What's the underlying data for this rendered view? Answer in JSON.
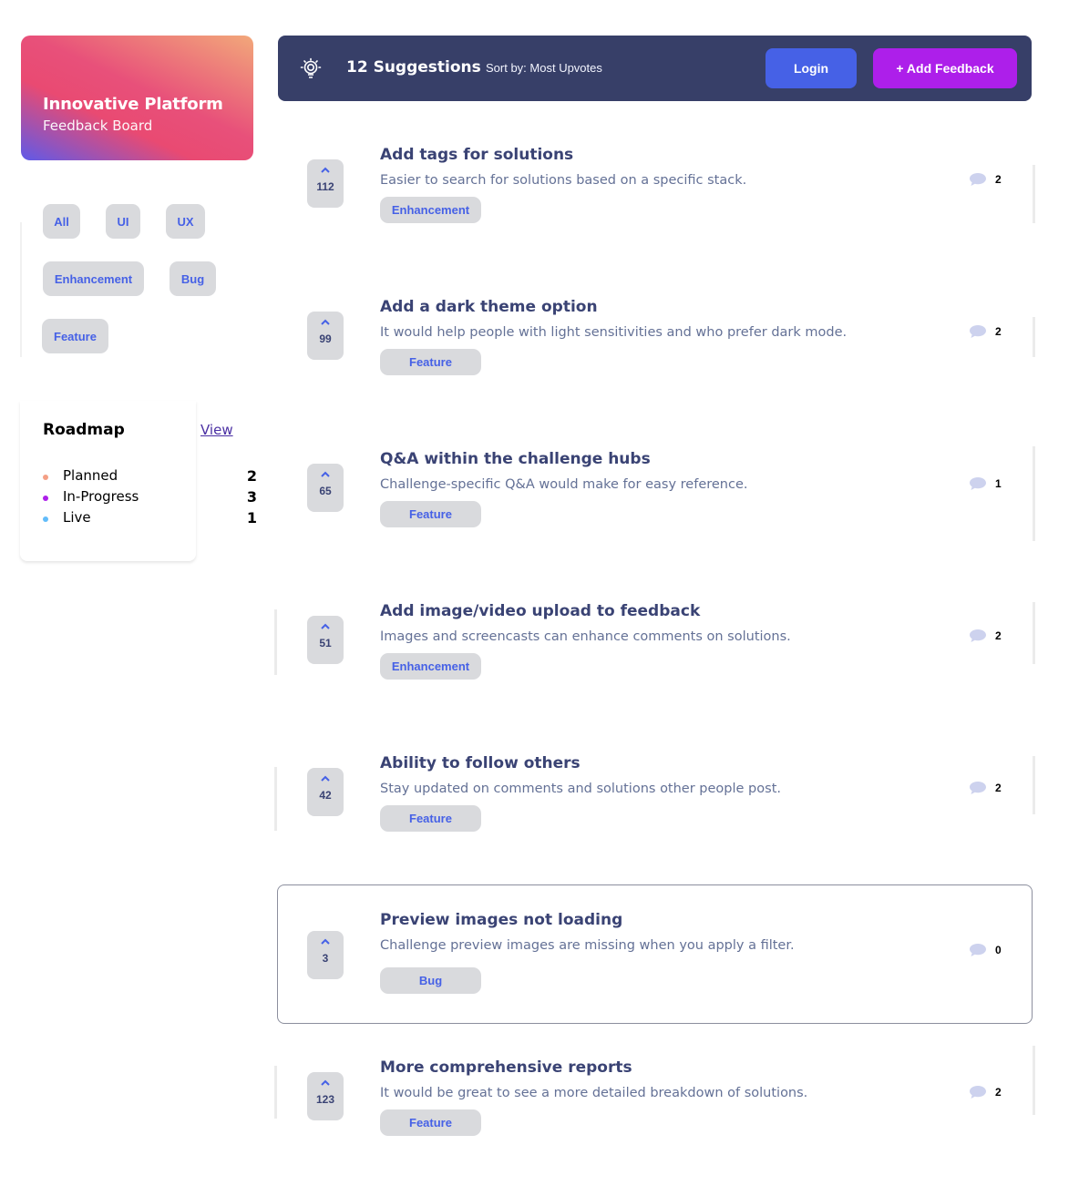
{
  "brand": {
    "title": "Innovative Platform",
    "subtitle": "Feedback Board"
  },
  "categories": [
    "All",
    "UI",
    "UX",
    "Enhancement",
    "Bug",
    "Feature"
  ],
  "roadmap": {
    "title": "Roadmap",
    "view_label": "View",
    "items": [
      {
        "label": "Planned",
        "count": "2",
        "color": "#f49f85"
      },
      {
        "label": "In-Progress",
        "count": "3",
        "color": "#ad1fea"
      },
      {
        "label": "Live",
        "count": "1",
        "color": "#62bcfa"
      }
    ]
  },
  "header": {
    "count_label": "12 Suggestions",
    "sort_label": "Sort by: Most Upvotes",
    "login_label": "Login",
    "add_label": "+ Add Feedback"
  },
  "feedback": [
    {
      "votes": "112",
      "title": "Add tags for solutions",
      "description": "Easier to search for solutions based on a specific stack.",
      "tag": "Enhancement",
      "comments": "2"
    },
    {
      "votes": "99",
      "title": "Add a dark theme option",
      "description": "It would help people with light sensitivities and who prefer dark mode.",
      "tag": "Feature",
      "comments": "2"
    },
    {
      "votes": "65",
      "title": "Q&A within the challenge hubs",
      "description": "Challenge-specific Q&A would make for easy reference.",
      "tag": "Feature",
      "comments": "1"
    },
    {
      "votes": "51",
      "title": "Add image/video upload to feedback",
      "description": "Images and screencasts can enhance comments on solutions.",
      "tag": "Enhancement",
      "comments": "2"
    },
    {
      "votes": "42",
      "title": "Ability to follow others",
      "description": "Stay updated on comments and solutions other people post.",
      "tag": "Feature",
      "comments": "2"
    },
    {
      "votes": "3",
      "title": "Preview images not loading",
      "description": "Challenge preview images are missing when you apply a filter.",
      "tag": "Bug",
      "comments": "0"
    },
    {
      "votes": "123",
      "title": "More comprehensive reports",
      "description": "It would be great to see a more detailed breakdown of solutions.",
      "tag": "Feature",
      "comments": "2"
    }
  ],
  "colors": {
    "accent_blue": "#4661e6",
    "accent_purple": "#ad1fea",
    "header_bg": "#373f68",
    "chip_bg": "#d9dadd",
    "heading_text": "#3a4374",
    "body_text": "#647196",
    "comment_icon": "#cdd2ee"
  }
}
